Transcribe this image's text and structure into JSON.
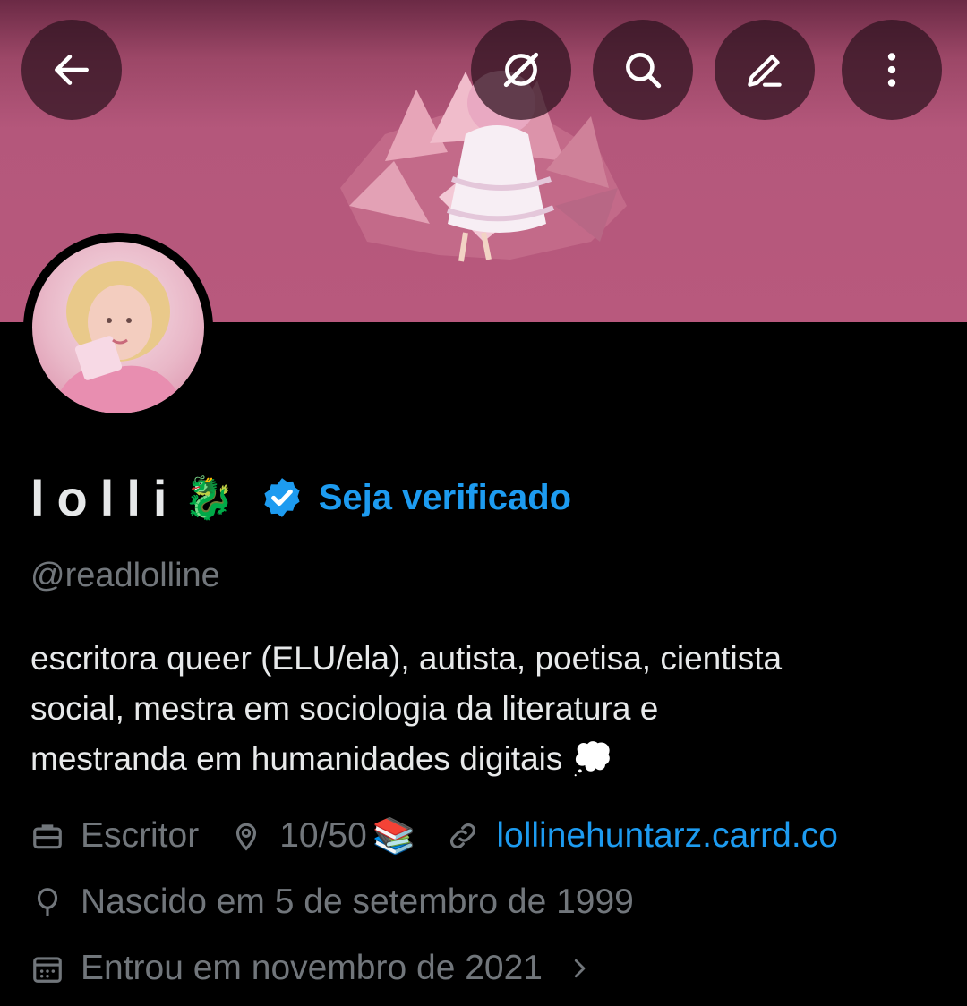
{
  "header": {
    "back_icon": "arrow-left-icon",
    "grok_icon": "grok-icon",
    "search_icon": "search-icon",
    "edit_icon": "pencil-icon",
    "more_icon": "more-vertical-icon"
  },
  "colors": {
    "banner": "#b8597d",
    "accent": "#1d9bf0",
    "muted": "#71767b",
    "text": "#e7e9ea",
    "background": "#000000"
  },
  "profile": {
    "name": "lolli",
    "name_emoji": "🐉",
    "verified_icon": "verified-badge-icon",
    "verify_link": "Seja verificado",
    "handle": "@readlolline",
    "bio_line1": "escritora queer (ELU/ela), autista, poetisa, cientista",
    "bio_line2": "social, mestra em sociologia da literatura e",
    "bio_line3": "mestranda em humanidades digitais",
    "bio_emoji": "💭"
  },
  "details": {
    "profession_icon": "briefcase-icon",
    "profession": "Escritor",
    "location_icon": "location-pin-icon",
    "location": "10/50",
    "location_emoji": "📚",
    "website_icon": "link-icon",
    "website": "lollinehuntarz.carrd.co",
    "birthday_icon": "balloon-icon",
    "birthday": "Nascido em 5 de setembro de 1999",
    "joined_icon": "calendar-icon",
    "joined": "Entrou em novembro de 2021"
  }
}
